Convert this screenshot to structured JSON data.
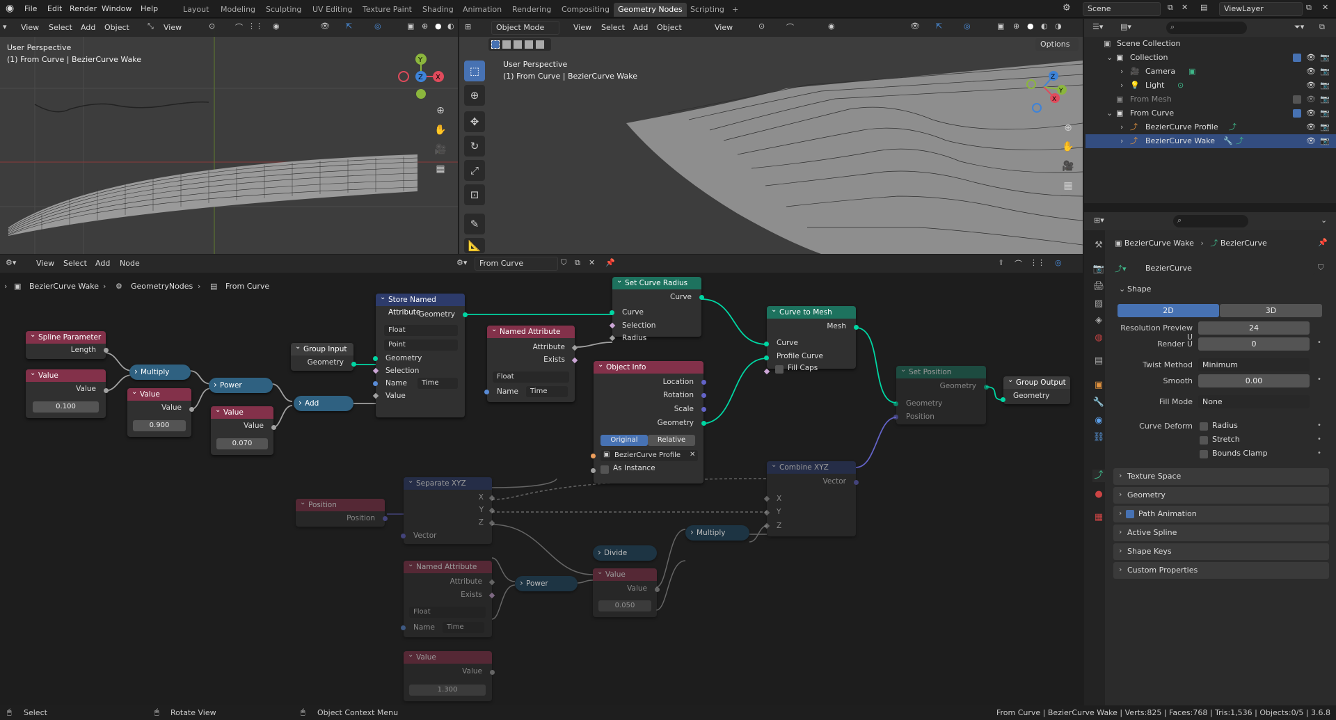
{
  "topbar": {
    "menus": [
      "File",
      "Edit",
      "Render",
      "Window",
      "Help"
    ],
    "workspaces": [
      "Layout",
      "Modeling",
      "Sculpting",
      "UV Editing",
      "Texture Paint",
      "Shading",
      "Animation",
      "Rendering",
      "Compositing",
      "Geometry Nodes",
      "Scripting"
    ],
    "add_tab": "+",
    "scene": "Scene",
    "view_layer": "ViewLayer"
  },
  "left_viewport": {
    "menus": [
      "View",
      "Select",
      "Add",
      "Object"
    ],
    "view_dropdown": "View",
    "title": "User Perspective",
    "subtitle": "(1) From Curve | BezierCurve Wake"
  },
  "right_viewport": {
    "mode": "Object Mode",
    "menus": [
      "View",
      "Select",
      "Add",
      "Object"
    ],
    "view_dropdown": "View",
    "options": "Options",
    "title": "User Perspective",
    "subtitle": "(1) From Curve | BezierCurve Wake"
  },
  "gizmo": {
    "x": "X",
    "y": "Y",
    "z": "Z"
  },
  "node_editor": {
    "menus": [
      "View",
      "Select",
      "Add",
      "Node"
    ],
    "tree_name": "From Curve",
    "breadcrumb": [
      "BezierCurve Wake",
      "GeometryNodes",
      "From Curve"
    ]
  },
  "nodes": {
    "spline_param": {
      "title": "Spline Parameter",
      "length": "Length"
    },
    "value1": {
      "title": "Value",
      "out": "Value",
      "val": "0.100"
    },
    "multiply1": {
      "title": "Multiply"
    },
    "value2": {
      "title": "Value",
      "out": "Value",
      "val": "0.900"
    },
    "power1": {
      "title": "Power"
    },
    "value3": {
      "title": "Value",
      "out": "Value",
      "val": "0.070"
    },
    "add": {
      "title": "Add"
    },
    "group_input": {
      "title": "Group Input",
      "geometry": "Geometry"
    },
    "store_named": {
      "title": "Store Named Attribute",
      "geometry_out": "Geometry",
      "type": "Float",
      "domain": "Point",
      "geometry": "Geometry",
      "selection": "Selection",
      "name_lbl": "Name",
      "name_val": "Time",
      "value": "Value"
    },
    "named_attr1": {
      "title": "Named Attribute",
      "attribute": "Attribute",
      "exists": "Exists",
      "type": "Float",
      "name_lbl": "Name",
      "name_val": "Time"
    },
    "set_radius": {
      "title": "Set Curve Radius",
      "curve_out": "Curve",
      "curve": "Curve",
      "selection": "Selection",
      "radius": "Radius"
    },
    "object_info": {
      "title": "Object Info",
      "location": "Location",
      "rotation": "Rotation",
      "scale": "Scale",
      "geometry": "Geometry",
      "original": "Original",
      "relative": "Relative",
      "object": "BezierCurve Profile",
      "as_instance": "As Instance"
    },
    "curve_to_mesh": {
      "title": "Curve to Mesh",
      "mesh": "Mesh",
      "curve": "Curve",
      "profile": "Profile Curve",
      "fill_caps": "Fill Caps"
    },
    "set_position": {
      "title": "Set Position",
      "geometry_out": "Geometry",
      "geometry": "Geometry",
      "position": "Position"
    },
    "group_output": {
      "title": "Group Output",
      "geometry": "Geometry"
    },
    "separate_xyz": {
      "title": "Separate XYZ",
      "x": "X",
      "y": "Y",
      "z": "Z",
      "vector": "Vector"
    },
    "combine_xyz": {
      "title": "Combine XYZ",
      "vector": "Vector",
      "x": "X",
      "y": "Y",
      "z": "Z"
    },
    "position": {
      "title": "Position",
      "out": "Position"
    },
    "named_attr2": {
      "title": "Named Attribute",
      "attribute": "Attribute",
      "exists": "Exists",
      "type": "Float",
      "name_lbl": "Name",
      "name_val": "Time"
    },
    "power2": {
      "title": "Power"
    },
    "divide": {
      "title": "Divide"
    },
    "multiply2": {
      "title": "Multiply"
    },
    "value4": {
      "title": "Value",
      "out": "Value",
      "val": "0.050"
    },
    "value5": {
      "title": "Value",
      "out": "Value",
      "val": "1.300"
    }
  },
  "outliner": {
    "root": "Scene Collection",
    "items": [
      {
        "label": "Collection"
      },
      {
        "label": "Camera"
      },
      {
        "label": "Light"
      },
      {
        "label": "From Mesh"
      },
      {
        "label": "From Curve"
      },
      {
        "label": "BezierCurve Profile"
      },
      {
        "label": "BezierCurve Wake"
      }
    ]
  },
  "properties": {
    "breadcrumb_obj": "BezierCurve Wake",
    "breadcrumb_data": "BezierCurve",
    "data_name": "BezierCurve",
    "shape_panel": "Shape",
    "dim_2d": "2D",
    "dim_3d": "3D",
    "res_preview_lbl": "Resolution Preview U",
    "res_preview_val": "24",
    "render_u_lbl": "Render U",
    "render_u_val": "0",
    "twist_lbl": "Twist Method",
    "twist_val": "Minimum",
    "smooth_lbl": "Smooth",
    "smooth_val": "0.00",
    "fill_lbl": "Fill Mode",
    "fill_val": "None",
    "deform_lbl": "Curve Deform",
    "radius": "Radius",
    "stretch": "Stretch",
    "bounds": "Bounds Clamp",
    "panels": [
      "Texture Space",
      "Geometry",
      "Path Animation",
      "Active Spline",
      "Shape Keys",
      "Custom Properties"
    ]
  },
  "statusbar": {
    "select": "Select",
    "rotate": "Rotate View",
    "context": "Object Context Menu",
    "stats": "From Curve | BezierCurve Wake | Verts:825 | Faces:768 | Tris:1,536 | Objects:0/5 | 3.6.8"
  }
}
